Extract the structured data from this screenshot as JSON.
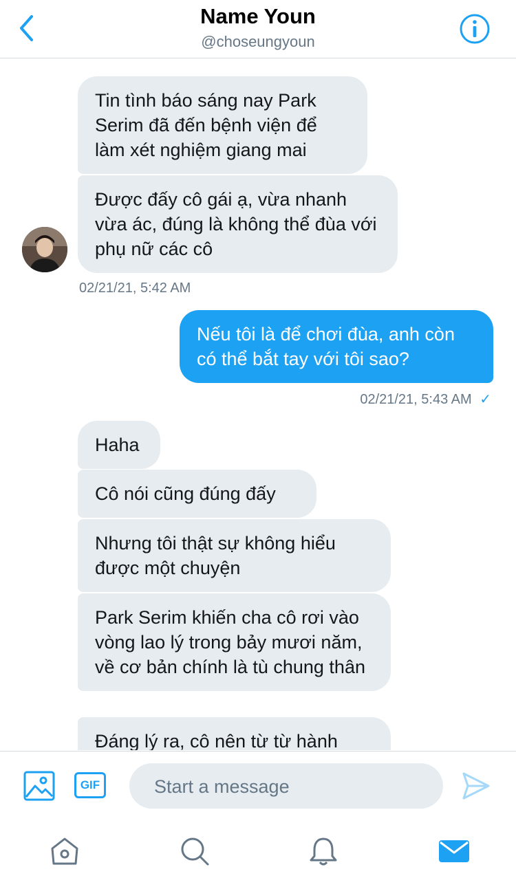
{
  "header": {
    "title": "Name Youn",
    "handle": "@choseungyoun"
  },
  "messages": [
    {
      "from": "them",
      "text": "Tin tình báo sáng nay Park Serim đã đến bệnh viện để làm xét nghiệm giang mai"
    },
    {
      "from": "them",
      "text": "Được đấy cô gái ạ, vừa nhanh vừa ác, đúng là không thể đùa với phụ nữ các cô"
    },
    {
      "from": "them",
      "timestamp": "02/21/21, 5:42 AM"
    },
    {
      "from": "me",
      "text": "Nếu tôi là để chơi đùa, anh còn có thể bắt tay với tôi sao?"
    },
    {
      "from": "me",
      "timestamp": "02/21/21, 5:43 AM",
      "status": "✓"
    },
    {
      "from": "them",
      "text": "Haha"
    },
    {
      "from": "them",
      "text": "Cô nói cũng đúng đấy"
    },
    {
      "from": "them",
      "text": "Nhưng tôi thật sự không hiểu được một chuyện"
    },
    {
      "from": "them",
      "text": "Park Serim khiến cha cô rơi vào vòng lao lý trong bảy mươi năm, về cơ bản chính là tù chung thân"
    },
    {
      "from": "them",
      "text": "Đáng lý ra, cô nên từ từ hành"
    }
  ],
  "composer": {
    "placeholder": "Start a message",
    "gif_label": "GIF",
    "image_icon": "image-icon",
    "send_icon": "send-icon"
  },
  "tabs": [
    {
      "name": "home-icon"
    },
    {
      "name": "search-icon"
    },
    {
      "name": "notifications-icon"
    },
    {
      "name": "messages-icon",
      "active": true
    }
  ],
  "colors": {
    "accent": "#1da1f2",
    "received_bubble": "#e6ecf0",
    "muted_text": "#657786"
  }
}
